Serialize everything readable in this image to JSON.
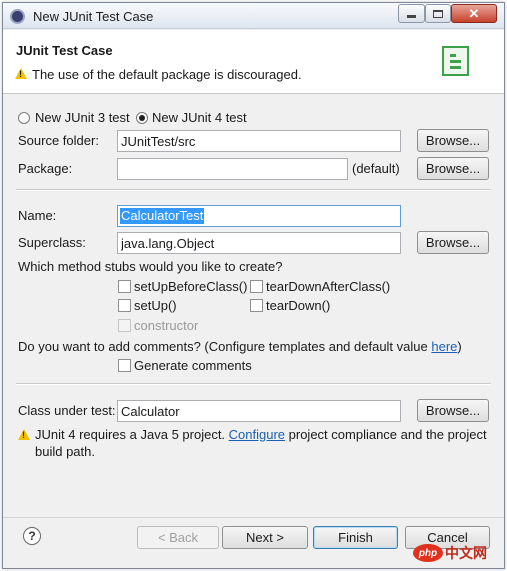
{
  "window": {
    "title": "New JUnit Test Case",
    "close_glyph": "✕"
  },
  "header": {
    "title": "JUnit Test Case",
    "message": "The use of the default package is discouraged."
  },
  "version": {
    "junit3_label": "New JUnit 3 test",
    "junit4_label": "New JUnit 4 test",
    "selected": "junit4"
  },
  "source_folder": {
    "label": "Source folder:",
    "value": "JUnitTest/src",
    "browse_label": "Browse..."
  },
  "package": {
    "label": "Package:",
    "value": "",
    "suffix": "(default)",
    "browse_label": "Browse..."
  },
  "name": {
    "label": "Name:",
    "value": "CalculatorTest"
  },
  "superclass": {
    "label": "Superclass:",
    "value": "java.lang.Object",
    "browse_label": "Browse..."
  },
  "stubs": {
    "question": "Which method stubs would you like to create?",
    "setup_before_class": "setUpBeforeClass()",
    "teardown_after_class": "tearDownAfterClass()",
    "setup": "setUp()",
    "teardown": "tearDown()",
    "constructor": "constructor"
  },
  "comments": {
    "question_prefix": "Do you want to add comments? (Configure templates and default value ",
    "link": "here",
    "question_suffix": ")",
    "generate_label": "Generate comments"
  },
  "class_under_test": {
    "label": "Class under test:",
    "value": "Calculator",
    "browse_label": "Browse..."
  },
  "warning": {
    "prefix": "JUnit 4 requires a Java 5 project. ",
    "link": "Configure",
    "suffix": " project compliance and the project",
    "line2": "build path."
  },
  "footer": {
    "help_glyph": "?",
    "back_label": "< Back",
    "next_label": "Next >",
    "finish_label": "Finish",
    "cancel_label": "Cancel"
  },
  "watermark": {
    "logo_text": "php",
    "text": "中文网"
  },
  "colors": {
    "warning": "#f2c200",
    "link": "#1a5fb4",
    "selection": "#3399ff"
  }
}
